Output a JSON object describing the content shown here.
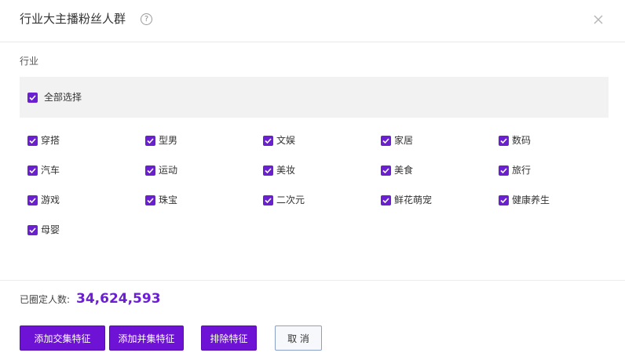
{
  "dialog": {
    "title": "行业大主播粉丝人群",
    "help_glyph": "?",
    "close_icon": "close-icon"
  },
  "industry": {
    "label": "行业",
    "select_all_label": "全部选择",
    "select_all_checked": true,
    "options": [
      {
        "label": "穿搭",
        "checked": true
      },
      {
        "label": "型男",
        "checked": true
      },
      {
        "label": "文娱",
        "checked": true
      },
      {
        "label": "家居",
        "checked": true
      },
      {
        "label": "数码",
        "checked": true
      },
      {
        "label": "汽车",
        "checked": true
      },
      {
        "label": "运动",
        "checked": true
      },
      {
        "label": "美妆",
        "checked": true
      },
      {
        "label": "美食",
        "checked": true
      },
      {
        "label": "旅行",
        "checked": true
      },
      {
        "label": "游戏",
        "checked": true
      },
      {
        "label": "珠宝",
        "checked": true
      },
      {
        "label": "二次元",
        "checked": true
      },
      {
        "label": "鲜花萌宠",
        "checked": true
      },
      {
        "label": "健康养生",
        "checked": true
      },
      {
        "label": "母婴",
        "checked": true
      }
    ]
  },
  "summary": {
    "count_label": "已圈定人数:",
    "count_value": "34,624,593"
  },
  "actions": {
    "intersection_label": "添加交集特征",
    "union_label": "添加并集特征",
    "exclude_label": "排除特征",
    "cancel_label": "取 消"
  },
  "colors": {
    "accent": "#6a1fd0",
    "button_primary": "#6e12d6"
  }
}
